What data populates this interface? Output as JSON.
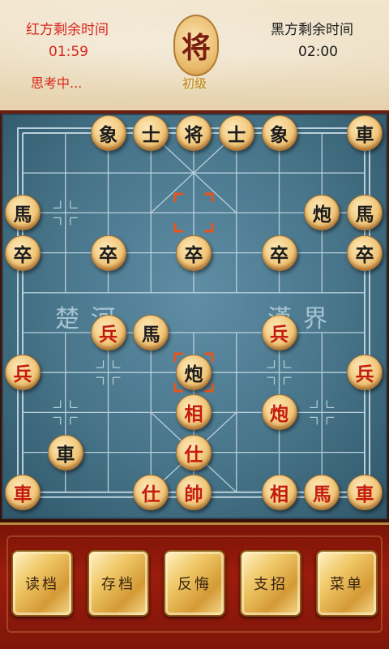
{
  "header": {
    "red_title": "红方剩余时间",
    "red_time": "01:59",
    "red_status": "思考中...",
    "black_title": "黑方剩余时间",
    "black_time": "02:00",
    "emblem": "将",
    "level": "初级"
  },
  "board": {
    "river_left": "楚河",
    "river_right": "漢界",
    "pieces": [
      {
        "col": 2,
        "row": 0,
        "char": "象",
        "color": "black"
      },
      {
        "col": 3,
        "row": 0,
        "char": "士",
        "color": "black"
      },
      {
        "col": 4,
        "row": 0,
        "char": "将",
        "color": "black"
      },
      {
        "col": 5,
        "row": 0,
        "char": "士",
        "color": "black"
      },
      {
        "col": 6,
        "row": 0,
        "char": "象",
        "color": "black"
      },
      {
        "col": 8,
        "row": 0,
        "char": "車",
        "color": "black"
      },
      {
        "col": 0,
        "row": 2,
        "char": "馬",
        "color": "black"
      },
      {
        "col": 7,
        "row": 2,
        "char": "炮",
        "color": "black"
      },
      {
        "col": 8,
        "row": 2,
        "char": "馬",
        "color": "black"
      },
      {
        "col": 0,
        "row": 3,
        "char": "卒",
        "color": "black"
      },
      {
        "col": 2,
        "row": 3,
        "char": "卒",
        "color": "black"
      },
      {
        "col": 4,
        "row": 3,
        "char": "卒",
        "color": "black"
      },
      {
        "col": 6,
        "row": 3,
        "char": "卒",
        "color": "black"
      },
      {
        "col": 8,
        "row": 3,
        "char": "卒",
        "color": "black"
      },
      {
        "col": 2,
        "row": 5,
        "char": "兵",
        "color": "red"
      },
      {
        "col": 3,
        "row": 5,
        "char": "馬",
        "color": "black"
      },
      {
        "col": 6,
        "row": 5,
        "char": "兵",
        "color": "red"
      },
      {
        "col": 0,
        "row": 6,
        "char": "兵",
        "color": "red"
      },
      {
        "col": 4,
        "row": 6,
        "char": "炮",
        "color": "black"
      },
      {
        "col": 8,
        "row": 6,
        "char": "兵",
        "color": "red"
      },
      {
        "col": 4,
        "row": 7,
        "char": "相",
        "color": "red"
      },
      {
        "col": 6,
        "row": 7,
        "char": "炮",
        "color": "red"
      },
      {
        "col": 1,
        "row": 8,
        "char": "車",
        "color": "black"
      },
      {
        "col": 4,
        "row": 8,
        "char": "仕",
        "color": "red"
      },
      {
        "col": 0,
        "row": 9,
        "char": "車",
        "color": "red"
      },
      {
        "col": 3,
        "row": 9,
        "char": "仕",
        "color": "red"
      },
      {
        "col": 4,
        "row": 9,
        "char": "帥",
        "color": "red"
      },
      {
        "col": 6,
        "row": 9,
        "char": "相",
        "color": "red"
      },
      {
        "col": 7,
        "row": 9,
        "char": "馬",
        "color": "red"
      },
      {
        "col": 8,
        "row": 9,
        "char": "車",
        "color": "red"
      }
    ],
    "selection_markers": [
      {
        "col": 4,
        "row": 2
      },
      {
        "col": 4,
        "row": 6
      }
    ],
    "highlight_color": "#e8551c"
  },
  "buttons": [
    {
      "label": "读档"
    },
    {
      "label": "存档"
    },
    {
      "label": "反悔"
    },
    {
      "label": "支招"
    },
    {
      "label": "菜单"
    }
  ]
}
